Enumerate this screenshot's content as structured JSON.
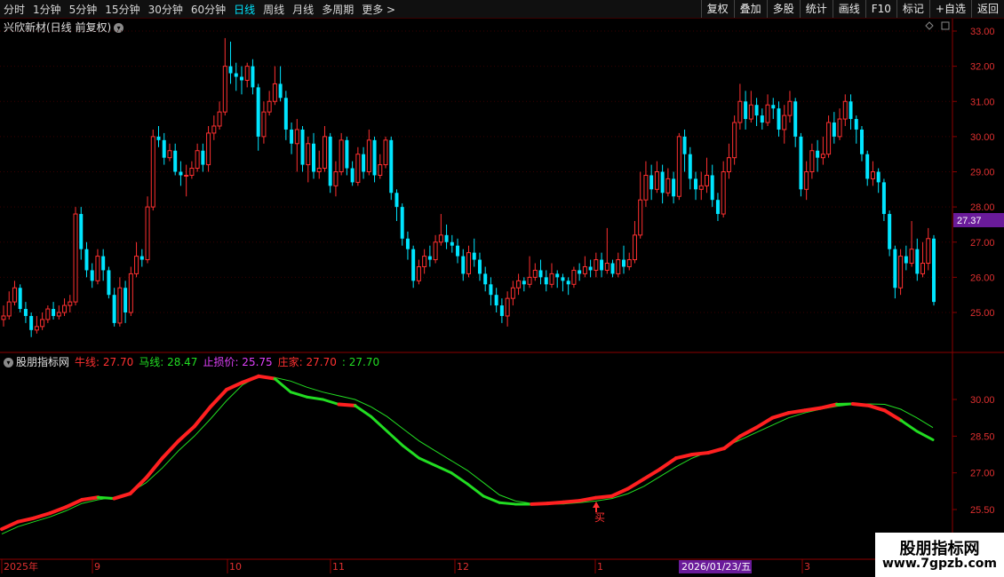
{
  "toolbar": {
    "periods": [
      "分时",
      "1分钟",
      "5分钟",
      "15分钟",
      "30分钟",
      "60分钟",
      "日线",
      "周线",
      "月线",
      "多周期",
      "更多"
    ],
    "active_period": "日线",
    "more_arrow": ">",
    "right_buttons": [
      "复权",
      "叠加",
      "多股",
      "统计",
      "画线",
      "F10",
      "标记",
      "+自选",
      "返回"
    ]
  },
  "chart_title": "兴欣新材(日线 前复权)",
  "price_axis": [
    "33.00",
    "32.00",
    "31.00",
    "30.00",
    "29.00",
    "28.00",
    "27.00",
    "26.00",
    "25.00"
  ],
  "current_price": "27.37",
  "indicator": {
    "name": "股朋指标网",
    "bull": "牛线: 27.70",
    "horse": "马线: 28.47",
    "stop": "止损价: 25.75",
    "zhuang": "庄家: 27.70",
    "extra": ": 27.70",
    "axis": [
      "30.00",
      "28.50",
      "27.00",
      "25.50"
    ],
    "buy_label": "买"
  },
  "date_axis": {
    "labels": [
      "2025年",
      "9",
      "10",
      "11",
      "12",
      "1",
      "3"
    ],
    "cursor_date": "2026/01/23/五"
  },
  "watermark": {
    "line1": "股朋指标网",
    "line2": "www.7gpzb.com"
  },
  "colors": {
    "up": "#ff3030",
    "down": "#00e5ff",
    "bull": "#ff2020",
    "bear": "#22dd22",
    "horse": "#22dd22"
  },
  "chart_data": [
    {
      "type": "candlestick",
      "ylim": [
        24.5,
        33.1
      ],
      "candles": [
        [
          24.8,
          24.9,
          25.2,
          24.6
        ],
        [
          24.9,
          25.3,
          25.6,
          24.8
        ],
        [
          25.3,
          25.7,
          25.9,
          25.2
        ],
        [
          25.7,
          25.1,
          25.8,
          25.0
        ],
        [
          25.1,
          24.9,
          25.3,
          24.7
        ],
        [
          24.9,
          24.5,
          25.0,
          24.3
        ],
        [
          24.5,
          24.6,
          24.9,
          24.4
        ],
        [
          24.6,
          24.8,
          25.0,
          24.5
        ],
        [
          24.8,
          25.1,
          25.2,
          24.7
        ],
        [
          25.1,
          24.9,
          25.3,
          24.8
        ],
        [
          24.9,
          25.0,
          25.2,
          24.8
        ],
        [
          25.0,
          25.2,
          25.4,
          24.9
        ],
        [
          25.2,
          25.3,
          25.5,
          25.0
        ],
        [
          25.3,
          27.8,
          28.0,
          25.2
        ],
        [
          27.8,
          26.8,
          28.0,
          26.5
        ],
        [
          26.8,
          26.2,
          27.0,
          26.0
        ],
        [
          26.2,
          25.9,
          26.4,
          25.7
        ],
        [
          25.9,
          26.6,
          26.8,
          25.8
        ],
        [
          26.6,
          26.2,
          26.8,
          25.9
        ],
        [
          26.2,
          25.5,
          26.3,
          25.4
        ],
        [
          25.5,
          24.7,
          25.7,
          24.6
        ],
        [
          24.7,
          25.7,
          26.0,
          24.6
        ],
        [
          25.7,
          25.0,
          25.9,
          24.7
        ],
        [
          25.0,
          26.1,
          26.3,
          24.9
        ],
        [
          26.1,
          26.6,
          27.0,
          26.0
        ],
        [
          26.6,
          26.5,
          26.8,
          26.3
        ],
        [
          26.5,
          28.0,
          28.3,
          26.4
        ],
        [
          28.0,
          30.0,
          30.2,
          27.9
        ],
        [
          30.0,
          29.9,
          30.3,
          29.7
        ],
        [
          29.9,
          29.4,
          30.1,
          29.2
        ],
        [
          29.4,
          29.6,
          29.8,
          29.3
        ],
        [
          29.6,
          29.0,
          29.8,
          28.9
        ],
        [
          29.0,
          28.9,
          29.3,
          28.6
        ],
        [
          28.9,
          28.9,
          29.2,
          28.3
        ],
        [
          28.9,
          29.1,
          29.3,
          28.8
        ],
        [
          29.1,
          29.6,
          29.8,
          29.0
        ],
        [
          29.6,
          29.2,
          29.8,
          29.0
        ],
        [
          29.2,
          30.1,
          30.3,
          29.0
        ],
        [
          30.1,
          30.3,
          30.6,
          29.9
        ],
        [
          30.3,
          30.7,
          31.0,
          30.2
        ],
        [
          30.7,
          32.0,
          32.8,
          30.6
        ],
        [
          32.0,
          31.8,
          32.7,
          31.5
        ],
        [
          31.8,
          31.7,
          32.1,
          31.3
        ],
        [
          31.7,
          31.6,
          32.0,
          31.2
        ],
        [
          31.6,
          32.0,
          32.1,
          31.4
        ],
        [
          32.0,
          31.4,
          32.2,
          31.2
        ],
        [
          31.4,
          30.0,
          31.5,
          29.6
        ],
        [
          30.0,
          30.7,
          31.0,
          29.8
        ],
        [
          30.7,
          31.0,
          31.3,
          30.6
        ],
        [
          31.0,
          31.5,
          32.0,
          30.9
        ],
        [
          31.5,
          31.1,
          32.0,
          31.0
        ],
        [
          31.1,
          30.2,
          31.3,
          29.9
        ],
        [
          30.2,
          29.8,
          30.4,
          29.5
        ],
        [
          29.8,
          30.2,
          30.5,
          29.0
        ],
        [
          30.2,
          29.2,
          30.3,
          29.0
        ],
        [
          29.2,
          29.8,
          30.0,
          28.7
        ],
        [
          29.8,
          29.0,
          30.1,
          28.8
        ],
        [
          29.0,
          29.1,
          29.6,
          28.8
        ],
        [
          29.1,
          30.0,
          30.3,
          29.0
        ],
        [
          30.0,
          28.6,
          30.1,
          28.4
        ],
        [
          28.6,
          29.0,
          29.3,
          28.3
        ],
        [
          29.0,
          29.9,
          30.1,
          28.9
        ],
        [
          29.9,
          29.1,
          30.0,
          28.9
        ],
        [
          29.1,
          28.7,
          29.3,
          28.6
        ],
        [
          28.7,
          29.5,
          29.7,
          28.6
        ],
        [
          29.5,
          29.0,
          29.7,
          28.8
        ],
        [
          29.0,
          29.9,
          30.2,
          28.9
        ],
        [
          29.9,
          28.9,
          30.0,
          28.7
        ],
        [
          28.9,
          29.2,
          29.5,
          28.8
        ],
        [
          29.2,
          29.9,
          30.0,
          29.1
        ],
        [
          29.9,
          28.4,
          30.0,
          28.2
        ],
        [
          28.4,
          28.0,
          28.5,
          27.6
        ],
        [
          28.0,
          27.1,
          28.1,
          26.9
        ],
        [
          27.1,
          26.8,
          27.3,
          26.5
        ],
        [
          26.8,
          25.9,
          26.9,
          25.7
        ],
        [
          25.9,
          26.3,
          26.5,
          25.8
        ],
        [
          26.3,
          26.6,
          26.8,
          26.1
        ],
        [
          26.6,
          26.5,
          26.9,
          26.3
        ],
        [
          26.5,
          27.0,
          27.2,
          26.4
        ],
        [
          27.0,
          27.2,
          27.8,
          26.9
        ],
        [
          27.2,
          27.0,
          27.5,
          26.8
        ],
        [
          27.0,
          26.9,
          27.2,
          26.7
        ],
        [
          26.9,
          26.6,
          27.1,
          26.4
        ],
        [
          26.6,
          26.1,
          26.8,
          25.9
        ],
        [
          26.1,
          26.7,
          26.9,
          26.0
        ],
        [
          26.7,
          26.5,
          27.1,
          26.3
        ],
        [
          26.5,
          26.1,
          26.7,
          25.9
        ],
        [
          26.1,
          25.8,
          26.3,
          25.6
        ],
        [
          25.8,
          25.5,
          26.0,
          25.2
        ],
        [
          25.5,
          25.2,
          25.7,
          25.0
        ],
        [
          25.2,
          24.9,
          25.4,
          24.7
        ],
        [
          24.9,
          25.4,
          25.6,
          24.6
        ],
        [
          25.4,
          25.7,
          25.9,
          25.2
        ],
        [
          25.7,
          25.9,
          26.1,
          25.5
        ],
        [
          25.9,
          25.8,
          26.0,
          25.6
        ],
        [
          25.8,
          26.0,
          26.6,
          25.7
        ],
        [
          26.0,
          26.2,
          26.4,
          25.9
        ],
        [
          26.2,
          26.0,
          26.5,
          25.8
        ],
        [
          26.0,
          25.8,
          26.2,
          25.6
        ],
        [
          25.8,
          26.1,
          26.4,
          25.7
        ],
        [
          26.1,
          26.0,
          26.2,
          25.7
        ],
        [
          26.0,
          25.9,
          26.1,
          25.6
        ],
        [
          25.9,
          25.8,
          26.0,
          25.5
        ],
        [
          25.8,
          26.2,
          26.3,
          25.7
        ],
        [
          26.2,
          26.1,
          26.4,
          25.9
        ],
        [
          26.1,
          26.3,
          26.6,
          26.0
        ],
        [
          26.3,
          26.2,
          26.5,
          26.0
        ],
        [
          26.2,
          26.5,
          26.7,
          26.0
        ],
        [
          26.5,
          26.2,
          26.7,
          26.0
        ],
        [
          26.2,
          26.4,
          27.4,
          26.1
        ],
        [
          26.4,
          26.1,
          26.5,
          26.0
        ],
        [
          26.1,
          26.5,
          26.7,
          26.0
        ],
        [
          26.5,
          26.3,
          26.9,
          26.1
        ],
        [
          26.3,
          26.5,
          26.7,
          26.2
        ],
        [
          26.5,
          27.2,
          27.6,
          26.4
        ],
        [
          27.2,
          28.2,
          29.0,
          27.1
        ],
        [
          28.2,
          28.9,
          29.3,
          28.0
        ],
        [
          28.9,
          28.5,
          29.2,
          28.2
        ],
        [
          28.5,
          29.0,
          29.3,
          28.4
        ],
        [
          29.0,
          28.4,
          29.2,
          28.1
        ],
        [
          28.4,
          28.8,
          29.1,
          28.3
        ],
        [
          28.8,
          28.3,
          29.0,
          28.1
        ],
        [
          28.3,
          30.0,
          30.1,
          28.2
        ],
        [
          30.0,
          29.5,
          30.2,
          29.0
        ],
        [
          29.5,
          28.8,
          29.7,
          28.5
        ],
        [
          28.8,
          28.5,
          29.0,
          28.2
        ],
        [
          28.5,
          28.6,
          29.0,
          28.2
        ],
        [
          28.6,
          28.9,
          29.4,
          28.4
        ],
        [
          28.9,
          28.2,
          29.2,
          28.0
        ],
        [
          28.2,
          27.8,
          28.4,
          27.6
        ],
        [
          27.8,
          29.0,
          29.3,
          27.7
        ],
        [
          29.0,
          29.4,
          29.8,
          28.8
        ],
        [
          29.4,
          30.4,
          30.6,
          29.2
        ],
        [
          30.4,
          31.0,
          31.5,
          30.2
        ],
        [
          31.0,
          30.5,
          31.3,
          30.2
        ],
        [
          30.5,
          30.9,
          31.3,
          30.4
        ],
        [
          30.9,
          30.6,
          31.1,
          30.3
        ],
        [
          30.6,
          30.4,
          30.8,
          30.2
        ],
        [
          30.4,
          30.9,
          31.2,
          30.3
        ],
        [
          30.9,
          30.8,
          31.1,
          30.5
        ],
        [
          30.8,
          30.2,
          31.0,
          30.0
        ],
        [
          30.2,
          30.6,
          30.9,
          29.8
        ],
        [
          30.6,
          31.0,
          31.3,
          30.4
        ],
        [
          31.0,
          30.0,
          31.1,
          29.7
        ],
        [
          30.0,
          28.5,
          30.1,
          28.3
        ],
        [
          28.5,
          29.0,
          29.3,
          28.2
        ],
        [
          29.0,
          29.6,
          29.8,
          28.8
        ],
        [
          29.6,
          29.4,
          29.9,
          29.0
        ],
        [
          29.4,
          29.5,
          30.0,
          29.2
        ],
        [
          29.5,
          30.4,
          30.6,
          29.4
        ],
        [
          30.4,
          30.0,
          30.7,
          29.8
        ],
        [
          30.0,
          30.5,
          30.8,
          29.9
        ],
        [
          30.5,
          31.0,
          31.2,
          30.3
        ],
        [
          31.0,
          30.5,
          31.2,
          30.2
        ],
        [
          30.5,
          30.2,
          30.6,
          29.8
        ],
        [
          30.2,
          29.5,
          30.3,
          29.3
        ],
        [
          29.5,
          28.8,
          29.6,
          28.6
        ],
        [
          28.8,
          29.0,
          29.3,
          28.6
        ],
        [
          29.0,
          28.7,
          29.1,
          28.4
        ],
        [
          28.7,
          27.8,
          28.8,
          27.6
        ],
        [
          27.8,
          26.8,
          27.9,
          26.6
        ],
        [
          26.8,
          25.7,
          26.9,
          25.4
        ],
        [
          25.7,
          26.6,
          26.8,
          25.5
        ],
        [
          26.6,
          26.4,
          26.9,
          26.2
        ],
        [
          26.4,
          26.8,
          27.6,
          26.3
        ],
        [
          26.8,
          26.1,
          27.1,
          25.9
        ],
        [
          26.1,
          26.4,
          27.0,
          26.0
        ],
        [
          26.4,
          27.1,
          27.4,
          26.2
        ],
        [
          27.1,
          25.3,
          27.2,
          25.2
        ]
      ]
    },
    {
      "type": "line",
      "ylim": [
        24.6,
        31.2
      ],
      "series": [
        {
          "name": "牛线",
          "values": [
            24.7,
            25.0,
            25.15,
            25.35,
            25.6,
            25.9,
            26.0,
            25.95,
            26.15,
            26.8,
            27.6,
            28.3,
            28.9,
            29.7,
            30.4,
            30.7,
            30.95,
            30.85,
            30.3,
            30.1,
            30.0,
            29.8,
            29.75,
            29.3,
            28.7,
            28.1,
            27.6,
            27.3,
            27.0,
            26.55,
            26.05,
            25.78,
            25.72,
            25.72,
            25.75,
            25.8,
            25.86,
            25.98,
            26.05,
            26.35,
            26.75,
            27.15,
            27.6,
            27.75,
            27.82,
            28.0,
            28.5,
            28.85,
            29.25,
            29.45,
            29.55,
            29.65,
            29.8,
            29.82,
            29.75,
            29.55,
            29.15,
            28.7,
            28.35
          ]
        },
        {
          "name": "马线",
          "values": [
            24.5,
            24.8,
            25.0,
            25.2,
            25.45,
            25.75,
            25.9,
            26.0,
            26.2,
            26.6,
            27.2,
            27.9,
            28.5,
            29.2,
            29.95,
            30.6,
            30.95,
            30.9,
            30.75,
            30.5,
            30.3,
            30.15,
            30.0,
            29.7,
            29.3,
            28.8,
            28.3,
            27.9,
            27.5,
            27.1,
            26.6,
            26.1,
            25.85,
            25.75,
            25.72,
            25.73,
            25.78,
            25.85,
            25.95,
            26.15,
            26.45,
            26.85,
            27.25,
            27.6,
            27.85,
            28.05,
            28.35,
            28.65,
            28.95,
            29.25,
            29.45,
            29.6,
            29.72,
            29.8,
            29.82,
            29.8,
            29.6,
            29.25,
            28.85
          ]
        }
      ],
      "regime": [
        "bull",
        "bull",
        "bull",
        "bull",
        "bull",
        "bull",
        "bear",
        "bull",
        "bull",
        "bull",
        "bull",
        "bull",
        "bull",
        "bull",
        "bull",
        "bull",
        "bull",
        "bear",
        "bear",
        "bear",
        "bear",
        "bull",
        "bear",
        "bear",
        "bear",
        "bear",
        "bear",
        "bear",
        "bear",
        "bear",
        "bear",
        "bear",
        "bear",
        "bull",
        "bull",
        "bull",
        "bull",
        "bull",
        "bull",
        "bull",
        "bull",
        "bull",
        "bull",
        "bull",
        "bull",
        "bull",
        "bull",
        "bull",
        "bull",
        "bull",
        "bull",
        "bull",
        "bear",
        "bull",
        "bull",
        "bull",
        "bear",
        "bear",
        "bear"
      ]
    }
  ]
}
